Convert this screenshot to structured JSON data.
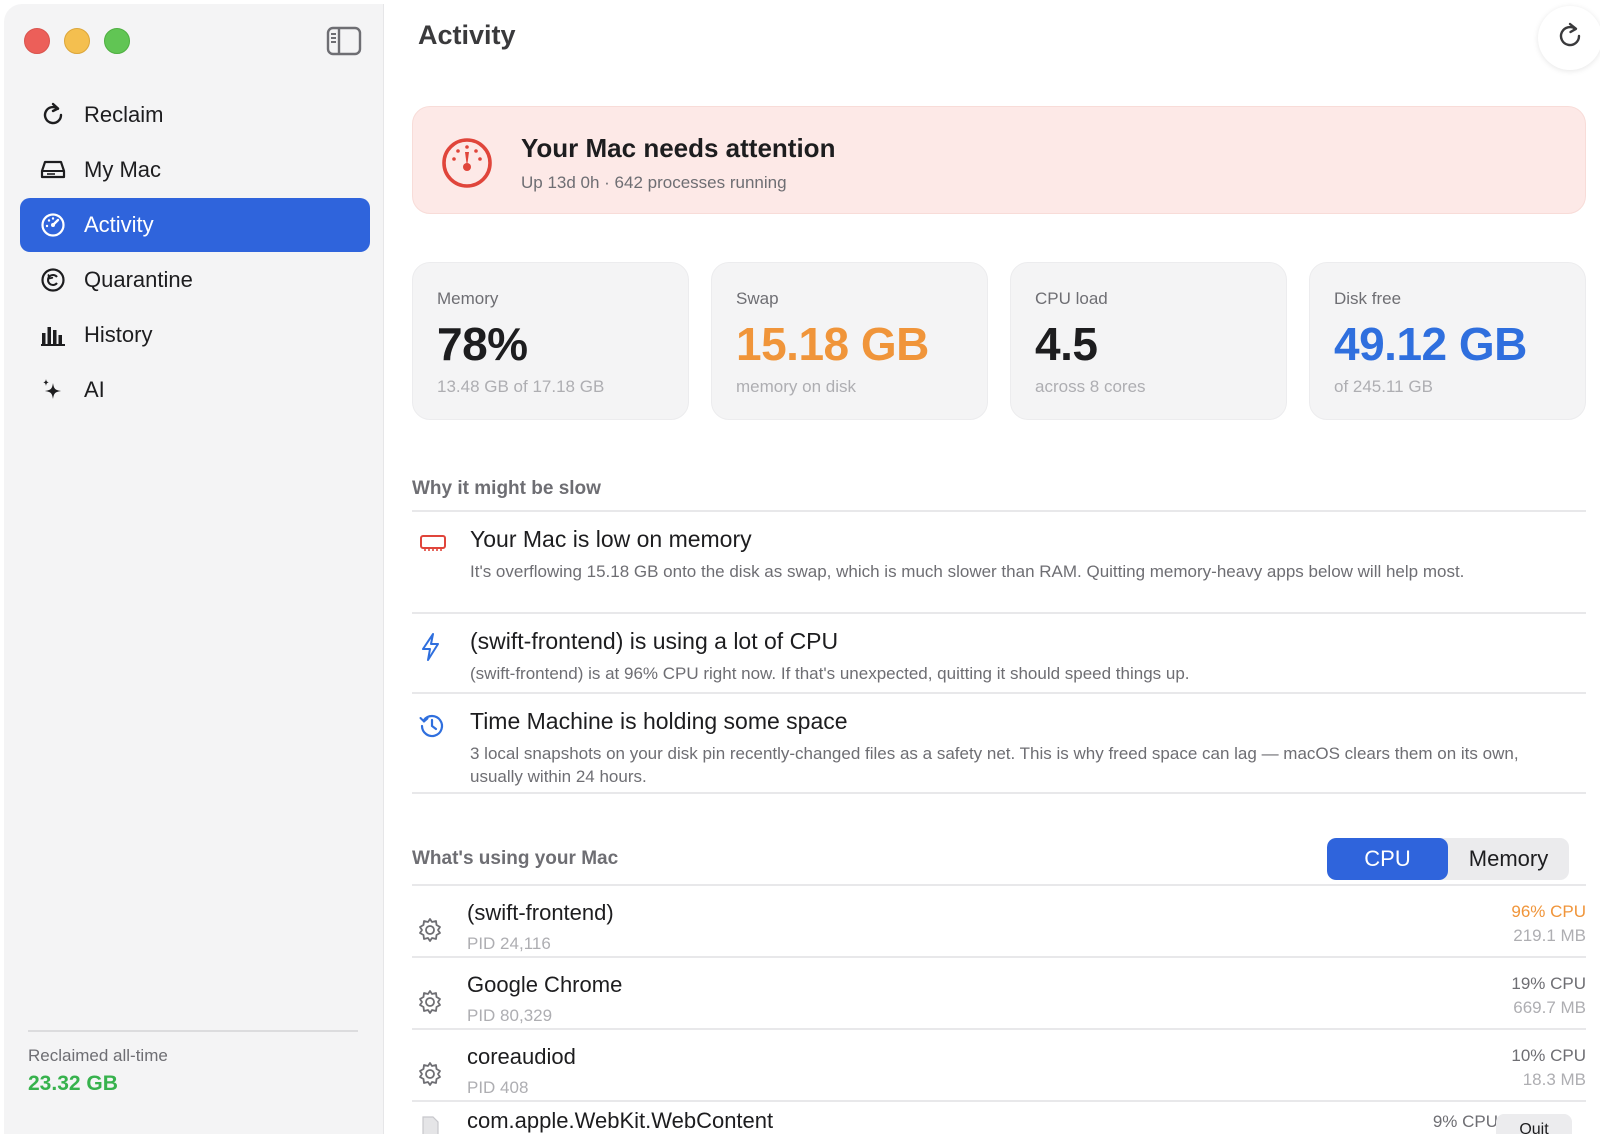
{
  "window": {
    "sidebar_toggle_icon": "sidebar-toggle-icon"
  },
  "sidebar": {
    "items": [
      {
        "label": "Reclaim",
        "icon": "refresh-icon"
      },
      {
        "label": "My Mac",
        "icon": "drive-icon"
      },
      {
        "label": "Activity",
        "icon": "gauge-icon",
        "active": true
      },
      {
        "label": "Quarantine",
        "icon": "restore-icon"
      },
      {
        "label": "History",
        "icon": "bar-chart-icon"
      },
      {
        "label": "AI",
        "icon": "sparkles-icon"
      }
    ],
    "footer": {
      "label": "Reclaimed all-time",
      "value": "23.32 GB"
    }
  },
  "header": {
    "title": "Activity"
  },
  "alert": {
    "title": "Your Mac needs attention",
    "subtitle": "Up 13d 0h · 642 processes running"
  },
  "stats": [
    {
      "label": "Memory",
      "value": "78%",
      "sub": "13.48 GB of 17.18 GB",
      "color": "#1d1d1f"
    },
    {
      "label": "Swap",
      "value": "15.18 GB",
      "sub": "memory on disk",
      "color": "#f0953a"
    },
    {
      "label": "CPU load",
      "value": "4.5",
      "sub": "across 8 cores",
      "color": "#1d1d1f"
    },
    {
      "label": "Disk free",
      "value": "49.12 GB",
      "sub": "of 245.11 GB",
      "color": "#2f6fde"
    }
  ],
  "reasons": {
    "section_title": "Why it might be slow",
    "items": [
      {
        "title": "Your Mac is low on memory",
        "desc": "It's overflowing 15.18 GB onto the disk as swap, which is much slower than RAM. Quitting memory-heavy apps below will help most.",
        "icon": "memory-chip-icon"
      },
      {
        "title": "(swift-frontend) is using a lot of CPU",
        "desc": "(swift-frontend) is at 96% CPU right now. If that's unexpected, quitting it should speed things up.",
        "icon": "bolt-icon"
      },
      {
        "title": "Time Machine is holding some space",
        "desc": "3 local snapshots on your disk pin recently-changed files as a safety net. This is why freed space can lag — macOS clears them on its own, usually within 24 hours.",
        "icon": "time-machine-icon"
      }
    ]
  },
  "processes": {
    "section_title": "What's using your Mac",
    "toggle": {
      "cpu": "CPU",
      "memory": "Memory",
      "selected": "CPU"
    },
    "rows": [
      {
        "name": "(swift-frontend)",
        "pid": "PID 24,116",
        "cpu": "96% CPU",
        "mem": "219.1 MB",
        "cpu_color": "#f0953a"
      },
      {
        "name": "Google Chrome",
        "pid": "PID 80,329",
        "cpu": "19% CPU",
        "mem": "669.7 MB",
        "cpu_color": "#6e6e73"
      },
      {
        "name": "coreaudiod",
        "pid": "PID 408",
        "cpu": "10% CPU",
        "mem": "18.3 MB",
        "cpu_color": "#6e6e73"
      },
      {
        "name": "com.apple.WebKit.WebContent",
        "pid": "",
        "cpu": "9% CPU",
        "mem": "",
        "cpu_color": "#6e6e73",
        "quit": "Quit"
      }
    ]
  }
}
